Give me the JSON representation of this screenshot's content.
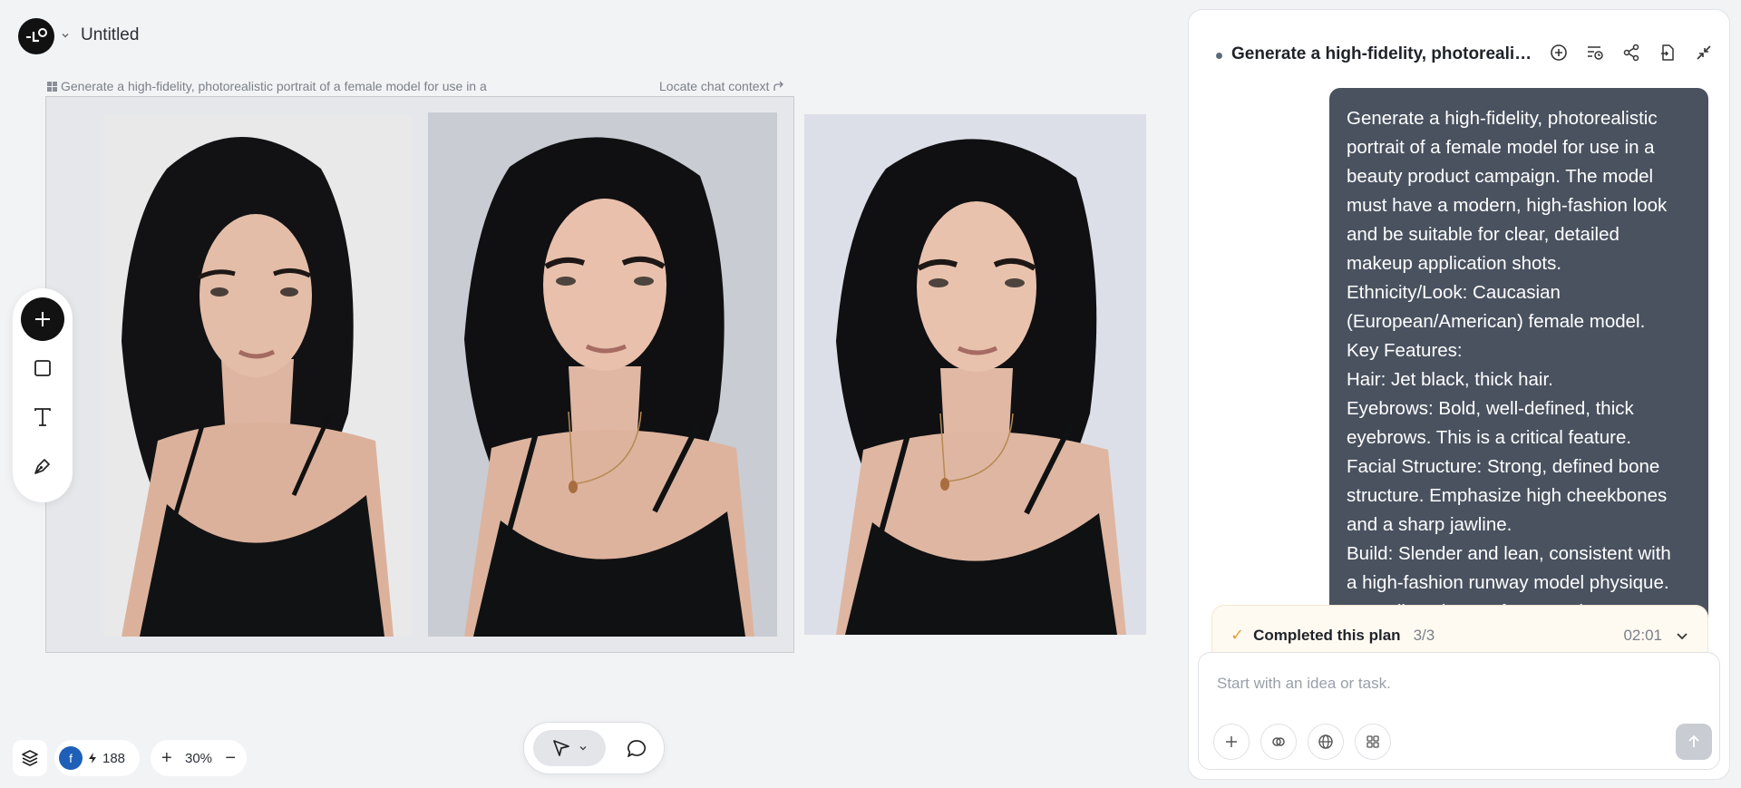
{
  "header": {
    "logo_alt": "LO",
    "title": "Untitled"
  },
  "canvas": {
    "frame_label": "Generate a high-fidelity, photorealistic portrait of a female model for use in a",
    "locate_link": "Locate chat context",
    "images": [
      "portrait-1",
      "portrait-2",
      "portrait-3"
    ]
  },
  "tools": [
    "add",
    "rectangle",
    "text",
    "pen"
  ],
  "status": {
    "avatar_letter": "f",
    "credits": "188",
    "zoom": "30%"
  },
  "chat": {
    "title": "Generate a high-fidelity, photorealisti...",
    "message_lines": [
      "Generate a high-fidelity, photorealistic",
      "portrait of a female model for use in a",
      "beauty product campaign. The model",
      "must have a modern, high-fashion look",
      "and be suitable for clear, detailed",
      "makeup application shots.",
      "Ethnicity/Look: Caucasian",
      "(European/American) female model.",
      "Key Features:",
      "Hair: Jet black, thick hair.",
      "Eyebrows: Bold, well-defined, thick",
      "eyebrows. This is a critical feature.",
      "Facial Structure: Strong, defined bone",
      "structure. Emphasize high cheekbones",
      "and a sharp jawline.",
      "Build: Slender and lean, consistent with",
      "a high-fashion runway model physique.",
      "Overall Look: A Reference Fl..."
    ],
    "plan": {
      "label": "Completed this plan",
      "count": "3/3",
      "time": "02:01"
    },
    "composer": {
      "placeholder": "Start with an idea or task."
    }
  },
  "colors": {
    "bubble_bg": "#4a5260",
    "plan_check": "#e0a23a",
    "avatar_bg": "#1e5fb8"
  }
}
